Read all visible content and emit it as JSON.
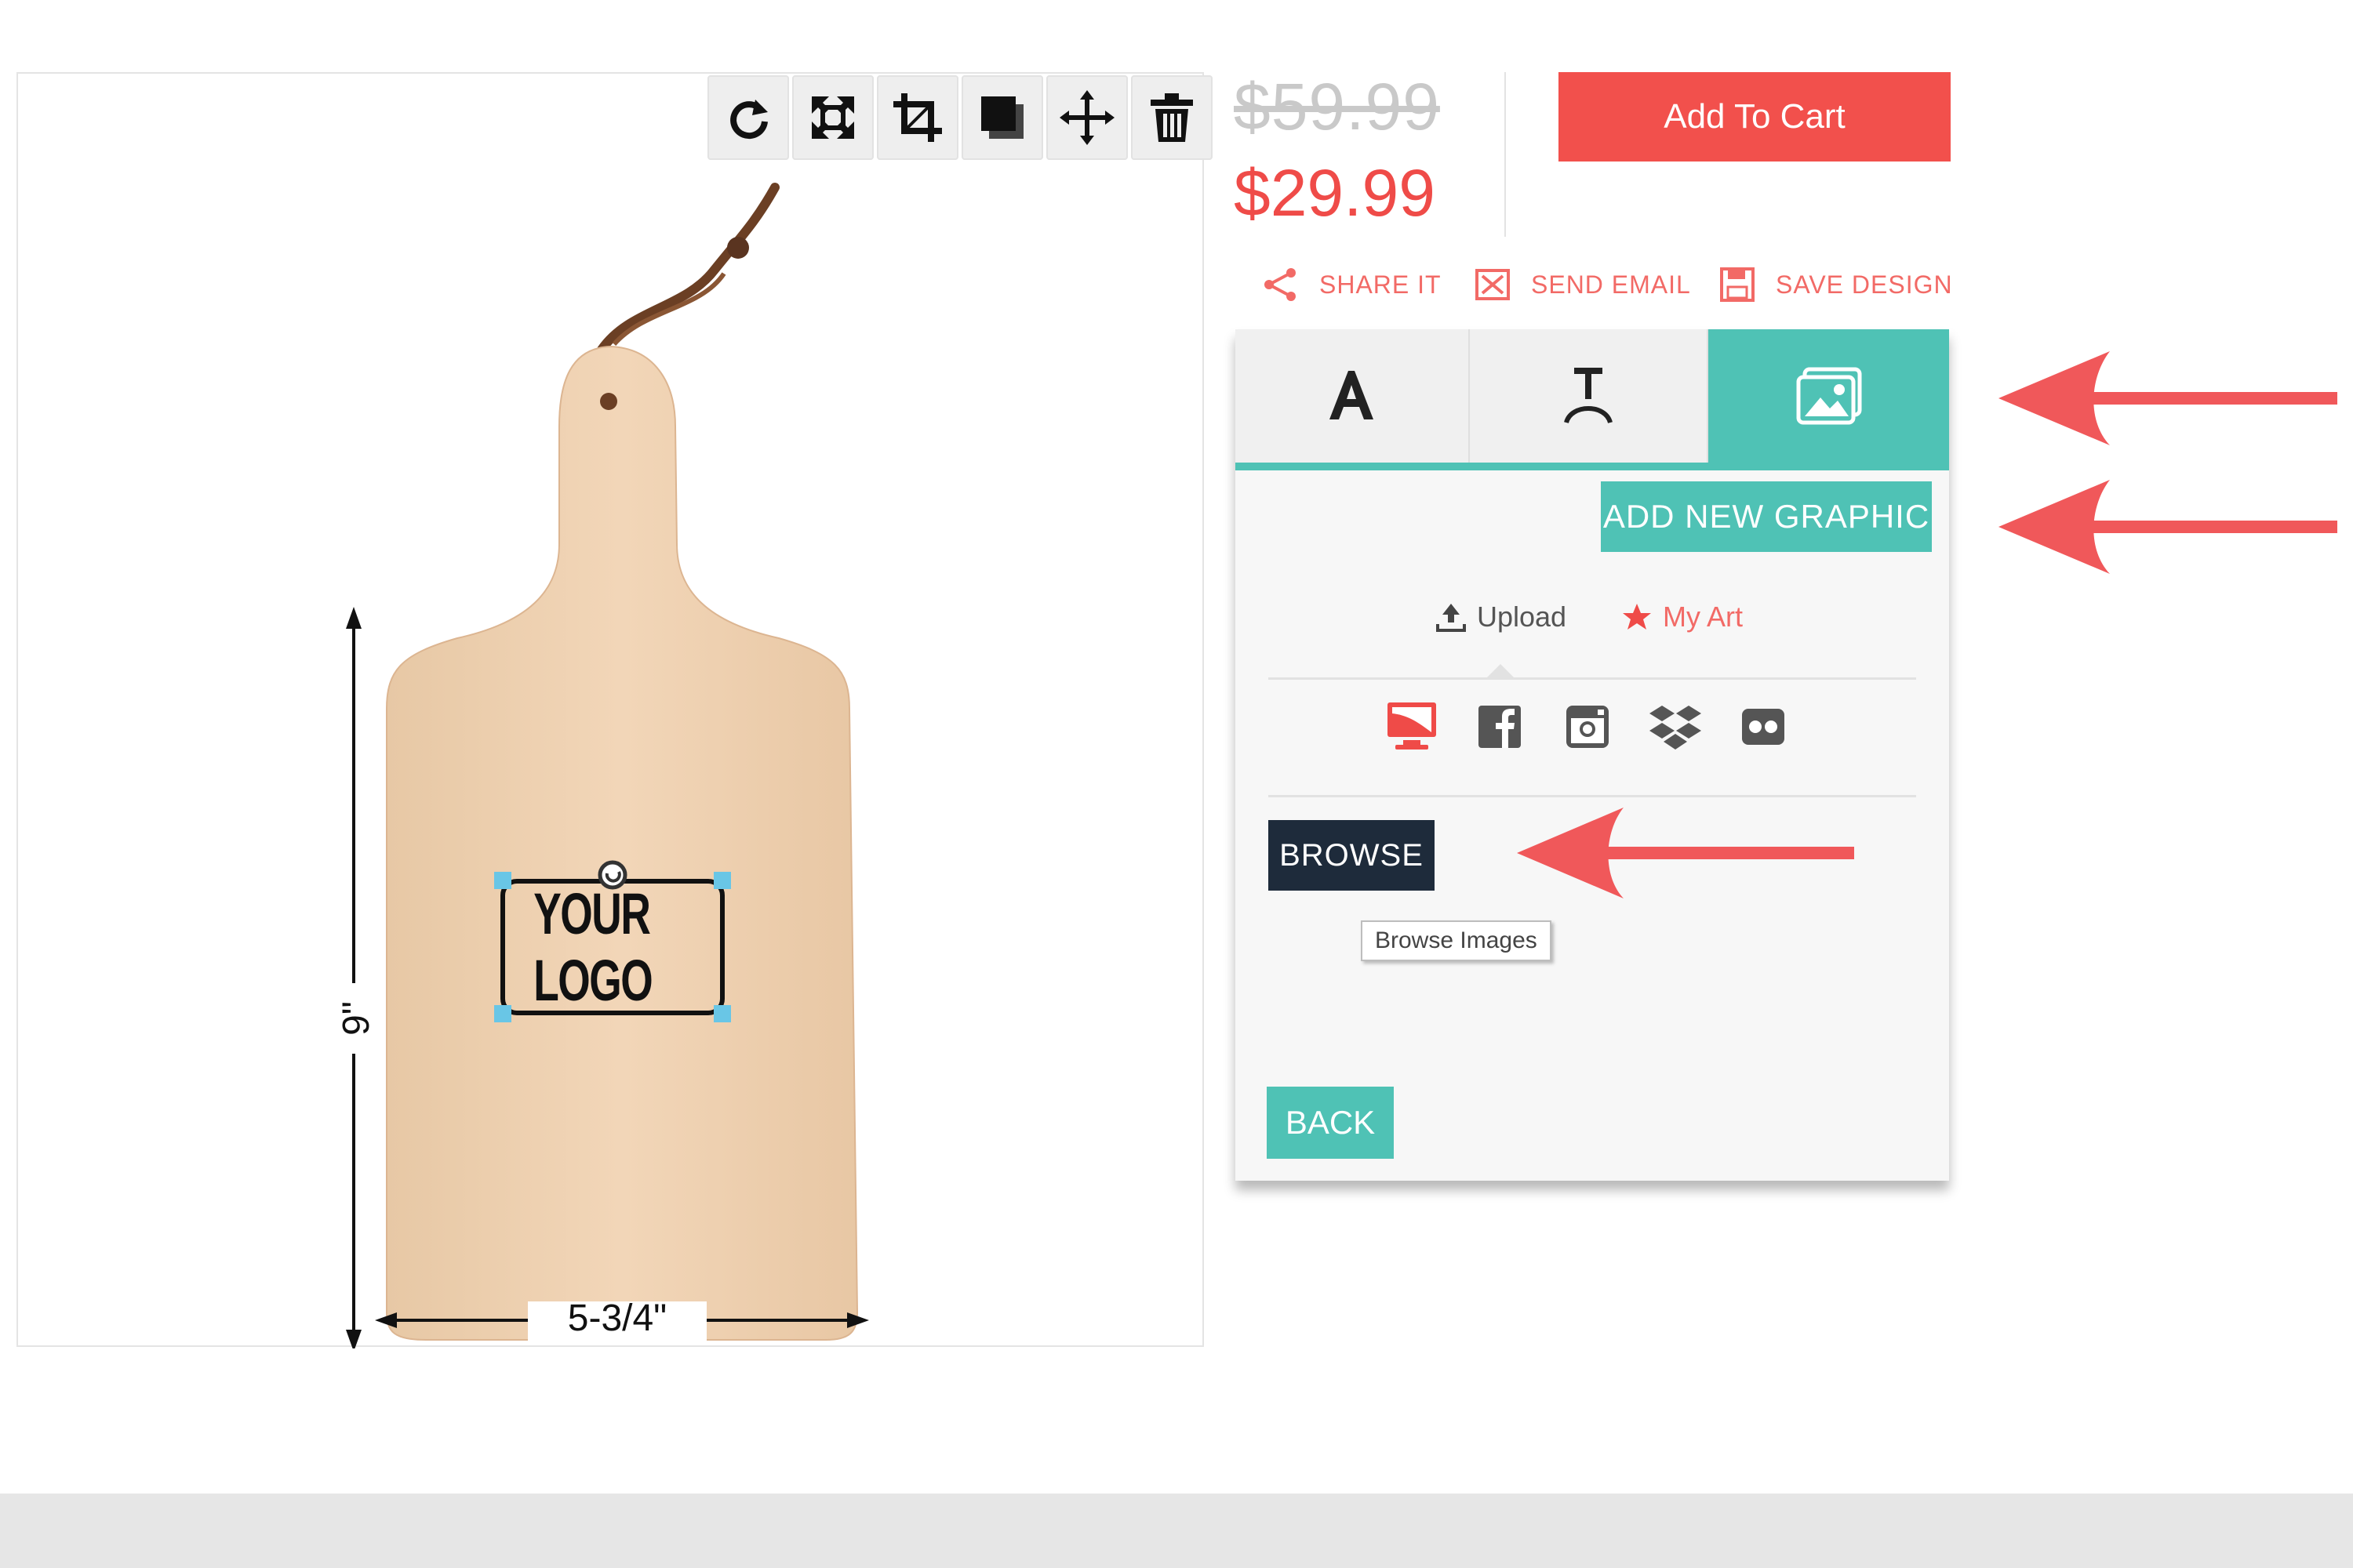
{
  "toolbar": {
    "tools": [
      {
        "name": "rotate-icon"
      },
      {
        "name": "fit-icon"
      },
      {
        "name": "crop-icon"
      },
      {
        "name": "layer-icon"
      },
      {
        "name": "move-icon"
      },
      {
        "name": "trash-icon"
      }
    ]
  },
  "product": {
    "logo_text": "YOUR LOGO",
    "height_label": "9\"",
    "width_label": "5-3/4\""
  },
  "pricing": {
    "old_price": "$59.99",
    "new_price": "$29.99",
    "add_to_cart": "Add To Cart"
  },
  "actions": {
    "share": "SHARE IT",
    "email": "SEND EMAIL",
    "save": "SAVE DESIGN"
  },
  "tabs": [
    {
      "name": "text-tab",
      "icon": "text-icon",
      "active": false
    },
    {
      "name": "curved-text-tab",
      "icon": "curved-text-icon",
      "active": false
    },
    {
      "name": "image-tab",
      "icon": "image-icon",
      "active": true
    }
  ],
  "panel": {
    "add_graphic": "ADD NEW GRAPHIC",
    "upload_label": "Upload",
    "myart_label": "My Art",
    "sources": [
      "computer-icon",
      "facebook-icon",
      "instagram-icon",
      "dropbox-icon",
      "flickr-icon"
    ],
    "browse_label": "BROWSE",
    "browse_tooltip": "Browse Images",
    "back_label": "BACK"
  },
  "colors": {
    "accent": "#4fc2b5",
    "cta": "#f2504c",
    "price": "#ef4b48",
    "dark_button": "#1e2b3b",
    "annotation_arrow": "#f0585a"
  }
}
